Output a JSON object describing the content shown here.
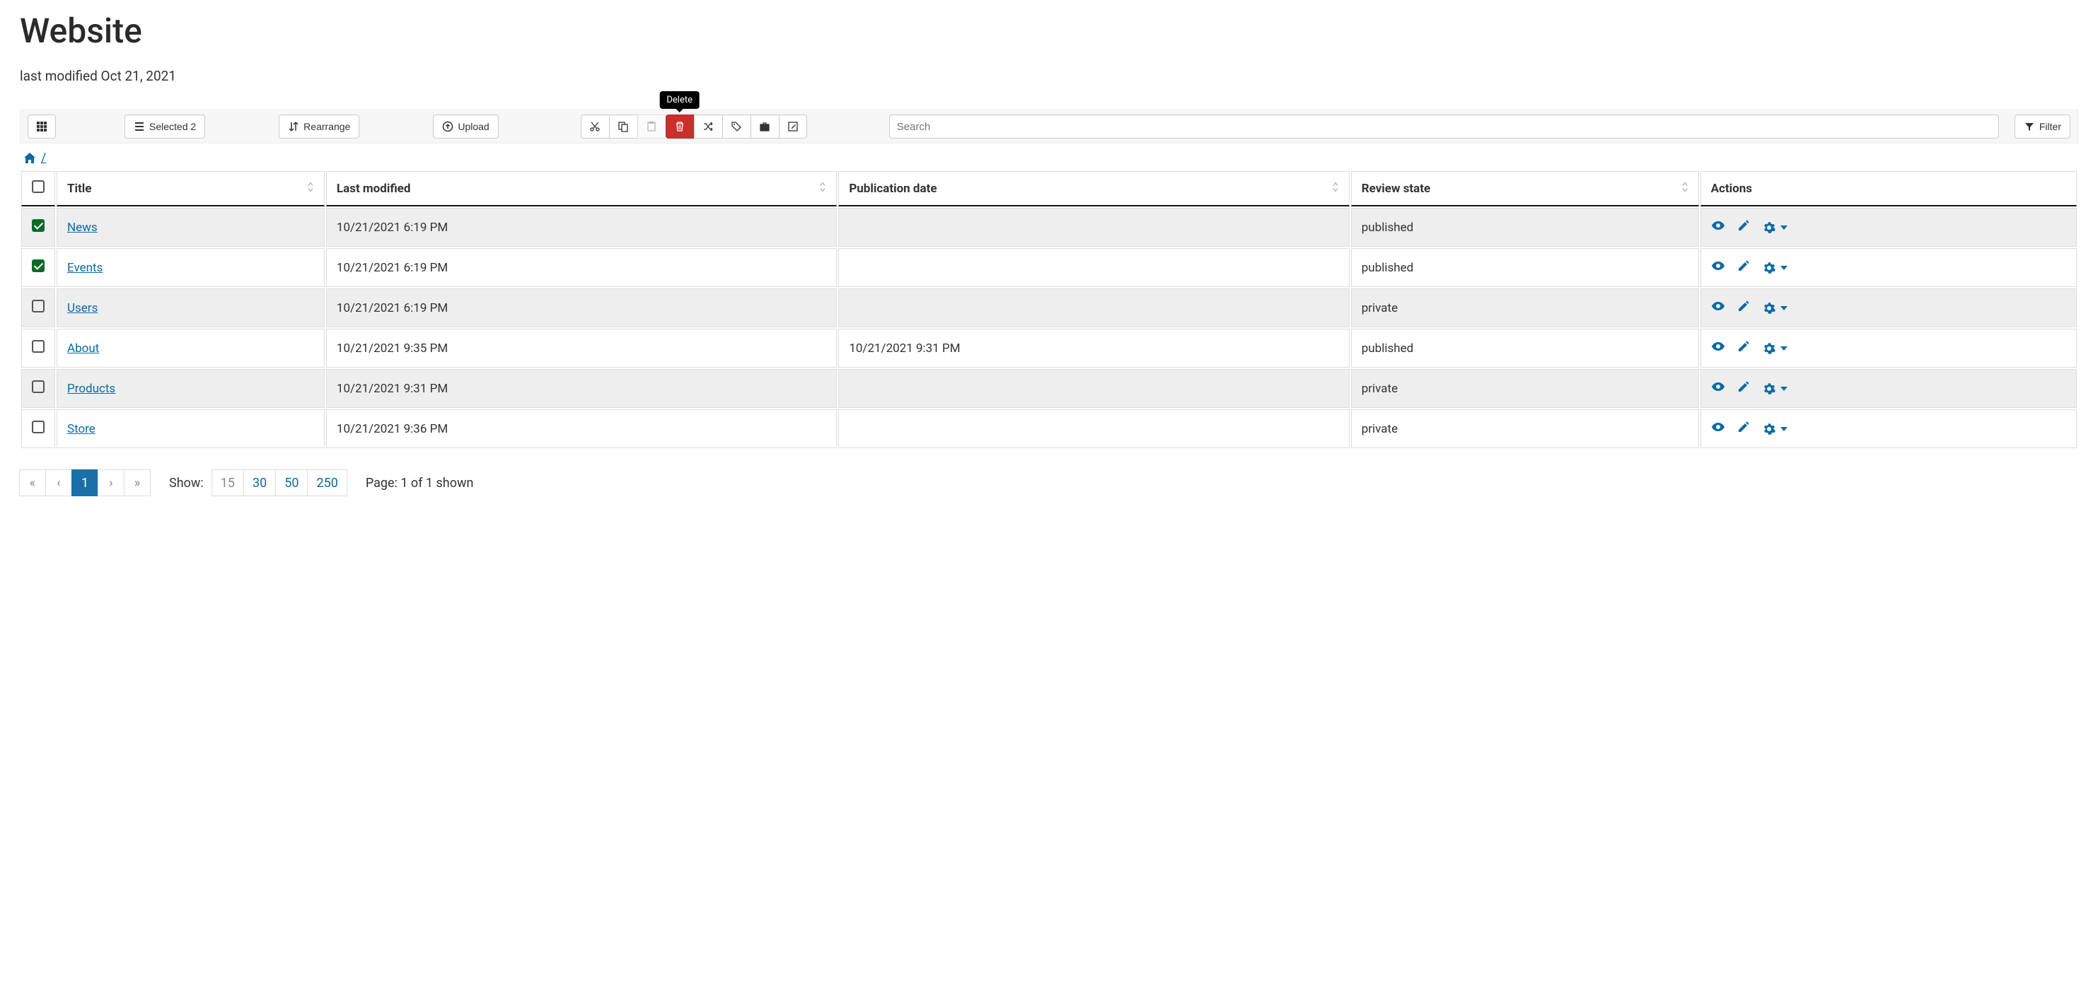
{
  "page": {
    "title": "Website",
    "subtitle": "last modified Oct 21, 2021"
  },
  "toolbar": {
    "selected_label": "Selected 2",
    "rearrange_label": "Rearrange",
    "upload_label": "Upload",
    "search_placeholder": "Search",
    "filter_label": "Filter",
    "delete_tooltip": "Delete"
  },
  "breadcrumb": {
    "sep": "/"
  },
  "table": {
    "headers": {
      "title": "Title",
      "last_modified": "Last modified",
      "publication_date": "Publication date",
      "review_state": "Review state",
      "actions": "Actions"
    },
    "rows": [
      {
        "selected": true,
        "title": "News",
        "last_modified": "10/21/2021 6:19 PM",
        "publication_date": "",
        "review_state": "published"
      },
      {
        "selected": true,
        "title": "Events",
        "last_modified": "10/21/2021 6:19 PM",
        "publication_date": "",
        "review_state": "published"
      },
      {
        "selected": false,
        "title": "Users",
        "last_modified": "10/21/2021 6:19 PM",
        "publication_date": "",
        "review_state": "private"
      },
      {
        "selected": false,
        "title": "About",
        "last_modified": "10/21/2021 9:35 PM",
        "publication_date": "10/21/2021 9:31 PM",
        "review_state": "published"
      },
      {
        "selected": false,
        "title": "Products",
        "last_modified": "10/21/2021 9:31 PM",
        "publication_date": "",
        "review_state": "private"
      },
      {
        "selected": false,
        "title": "Store",
        "last_modified": "10/21/2021 9:36 PM",
        "publication_date": "",
        "review_state": "private"
      }
    ]
  },
  "footer": {
    "show_label": "Show:",
    "page_sizes": [
      "15",
      "30",
      "50",
      "250"
    ],
    "current_page": "1",
    "page_info": "Page: 1 of 1 shown"
  }
}
